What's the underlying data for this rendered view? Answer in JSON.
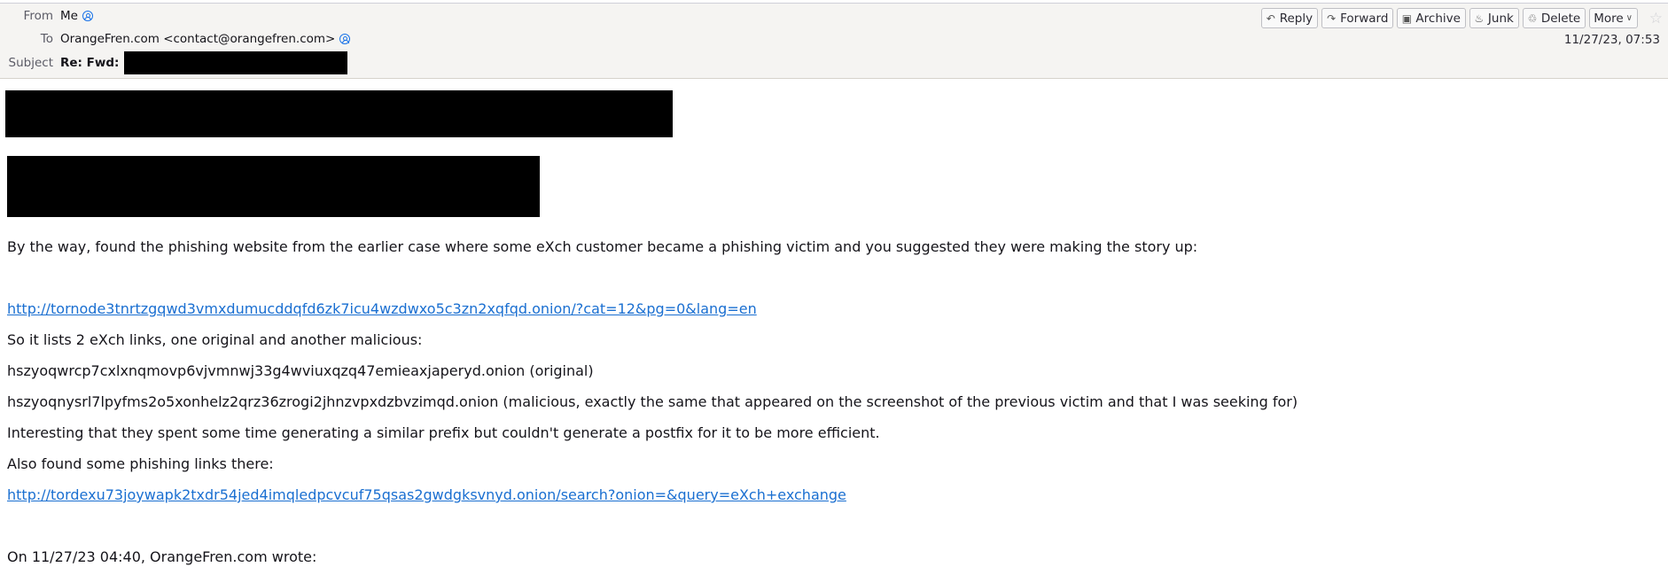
{
  "header": {
    "from_label": "From",
    "from_value": "Me",
    "to_label": "To",
    "to_value": "OrangeFren.com <contact@orangefren.com>",
    "subject_label": "Subject",
    "subject_prefix": "Re: Fwd:",
    "subject_redacted": true,
    "date": "11/27/23, 07:53"
  },
  "toolbar": {
    "buttons": [
      {
        "label": "Reply",
        "icon": "reply-icon",
        "glyph": "↶"
      },
      {
        "label": "Forward",
        "icon": "forward-icon",
        "glyph": "↷"
      },
      {
        "label": "Archive",
        "icon": "archive-icon",
        "glyph": "▣"
      },
      {
        "label": "Junk",
        "icon": "junk-icon",
        "glyph": "♨"
      },
      {
        "label": "Delete",
        "icon": "trash-icon",
        "glyph": "♲"
      },
      {
        "label": "More",
        "icon": "chevron-down-icon",
        "glyph": "∨"
      }
    ],
    "star_glyph": "☆"
  },
  "message": {
    "line1": "By the way, found the phishing website from the earlier case where some eXch customer became a phishing victim and you suggested they were making the story up:",
    "link1": "http://tornode3tnrtzgqwd3vmxdumucddqfd6zk7icu4wzdwxo5c3zn2xqfqd.onion/?cat=12&pg=0&lang=en",
    "line2": "So it lists 2 eXch links, one original and another malicious:",
    "line3": "hszyoqwrcp7cxlxnqmovp6vjvmnwj33g4wviuxqzq47emieaxjaperyd.onion (original)",
    "line4": "hszyoqnysrl7lpyfms2o5xonhelz2qrz36zrogi2jhnzvpxdzbvzimqd.onion (malicious, exactly the same that appeared on the screenshot of the previous victim and that I was seeking for)",
    "line5": "Interesting that they spent some time generating a similar prefix but couldn't generate a postfix for it to be more efficient.",
    "line6": "Also found some phishing links there:",
    "link2": "http://tordexu73joywapk2txdr54jed4imqledpcvcuf75qsas2gwdgksvnyd.onion/search?onion=&query=eXch+exchange",
    "quote_header": "On 11/27/23 04:40, OrangeFren.com wrote:"
  },
  "colors": {
    "link": "#1a6fd1",
    "contact_icon": "#1a73e8",
    "header_bg": "#f5f4f2",
    "redaction": "#000000"
  }
}
